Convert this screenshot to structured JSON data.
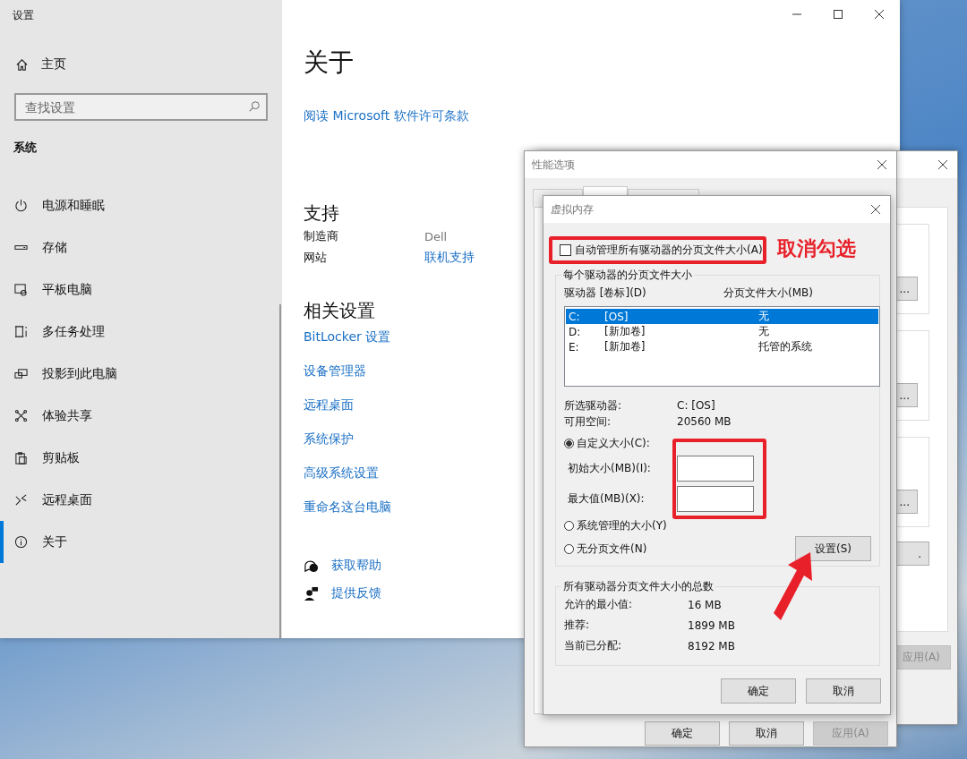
{
  "settings_window": {
    "title": "设置",
    "sidebar": {
      "home": "主页",
      "search": {
        "placeholder": "查找设置"
      },
      "section": "系统",
      "items": [
        {
          "label": "电源和睡眠",
          "kind": "power",
          "selected": false
        },
        {
          "label": "存储",
          "kind": "storage",
          "selected": false
        },
        {
          "label": "平板电脑",
          "kind": "tablet",
          "selected": false
        },
        {
          "label": "多任务处理",
          "kind": "multitask",
          "selected": false
        },
        {
          "label": "投影到此电脑",
          "kind": "project",
          "selected": false
        },
        {
          "label": "体验共享",
          "kind": "share",
          "selected": false
        },
        {
          "label": "剪贴板",
          "kind": "clipboard",
          "selected": false
        },
        {
          "label": "远程桌面",
          "kind": "remote",
          "selected": false
        },
        {
          "label": "关于",
          "kind": "info",
          "selected": true
        }
      ]
    },
    "content": {
      "title": "关于",
      "license_link": "阅读 Microsoft 软件许可条款",
      "support": {
        "heading": "支持",
        "rows": [
          {
            "label": "制造商",
            "value": "Dell",
            "kind": "text"
          },
          {
            "label": "网站",
            "value": "联机支持",
            "kind": "link"
          }
        ]
      },
      "related": {
        "heading": "相关设置",
        "links": [
          "BitLocker 设置",
          "设备管理器",
          "远程桌面",
          "系统保护",
          "高级系统设置",
          "重命名这台电脑"
        ]
      },
      "help_links": [
        {
          "label": "获取帮助",
          "kind": "help"
        },
        {
          "label": "提供反馈",
          "kind": "feedback"
        }
      ]
    }
  },
  "back_dialog": {
    "buttons": [
      "...",
      "...",
      "...",
      "."
    ],
    "apply": {
      "label": "应用(A)",
      "disabled": true
    }
  },
  "performance_dialog": {
    "title": "性能选项",
    "tabs": [
      {
        "selected": false
      },
      {
        "selected": true
      },
      {
        "selected": false
      }
    ],
    "buttons": [
      {
        "label": "确定",
        "disabled": false
      },
      {
        "label": "取消",
        "disabled": false
      },
      {
        "label": "应用(A)",
        "disabled": true
      }
    ]
  },
  "virtual_memory_dialog": {
    "title": "虚拟内存",
    "auto_manage": {
      "label": "自动管理所有驱动器的分页文件大小(A)",
      "checked": false
    },
    "drives_group": {
      "legend": "每个驱动器的分页文件大小",
      "columns": [
        "驱动器 [卷标](D)",
        "分页文件大小(MB)"
      ],
      "drives": [
        {
          "drive": "C:",
          "label": "[OS]",
          "size": "无",
          "selected": true
        },
        {
          "drive": "D:",
          "label": "[新加卷]",
          "size": "无",
          "selected": false
        },
        {
          "drive": "E:",
          "label": "[新加卷]",
          "size": "托管的系统",
          "selected": false
        }
      ],
      "info": [
        {
          "label": "所选驱动器:",
          "value": "C:  [OS]"
        },
        {
          "label": "可用空间:",
          "value": "20560 MB"
        }
      ],
      "options": [
        {
          "label": "自定义大小(C):",
          "selected": true
        },
        {
          "label": "系统管理的大小(Y)",
          "selected": false
        },
        {
          "label": "无分页文件(N)",
          "selected": false
        }
      ],
      "fields": [
        {
          "label": "初始大小(MB)(I):"
        },
        {
          "label": "最大值(MB)(X):"
        }
      ],
      "set_button": "设置(S)"
    },
    "totals_group": {
      "legend": "所有驱动器分页文件大小的总数",
      "rows": [
        {
          "label": "允许的最小值:",
          "value": "16 MB"
        },
        {
          "label": "推荐:",
          "value": "1899 MB"
        },
        {
          "label": "当前已分配:",
          "value": "8192 MB"
        }
      ]
    },
    "buttons": [
      "确定",
      "取消"
    ]
  },
  "annotation": {
    "label": "取消勾选"
  }
}
